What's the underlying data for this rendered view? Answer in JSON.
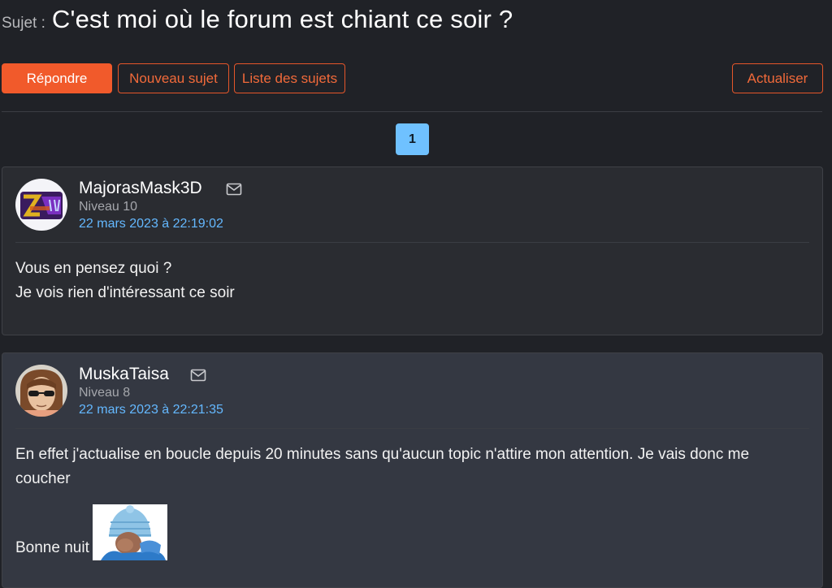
{
  "topic": {
    "label": "Sujet :",
    "title": "C'est moi où le forum est chiant ce soir ?"
  },
  "toolbar": {
    "reply_label": "Répondre",
    "new_topic_label": "Nouveau sujet",
    "topic_list_label": "Liste des sujets",
    "refresh_label": "Actualiser"
  },
  "pagination": {
    "current_page": "1"
  },
  "posts": [
    {
      "username": "MajorasMask3D",
      "level": "Niveau 10",
      "date": "22 mars 2023 à 22:19:02",
      "lines": [
        "Vous en pensez quoi ?",
        "Je vois rien d'intéressant ce soir"
      ],
      "icons": [
        "avatar-image",
        "mail-icon"
      ]
    },
    {
      "username": "MuskaTaisa",
      "level": "Niveau 8",
      "date": "22 mars 2023 à 22:21:35",
      "lines": [
        "En effet j'actualise en boucle depuis 20 minutes sans qu'aucun topic n'attire mon attention. Je vais donc me coucher",
        "Bonne nuit"
      ],
      "icons": [
        "avatar-image",
        "mail-icon",
        "sticker-image"
      ]
    }
  ],
  "colors": {
    "accent": "#f15a2b",
    "link": "#64b8ff",
    "page_active": "#6fc1ff",
    "background": "#202227"
  }
}
